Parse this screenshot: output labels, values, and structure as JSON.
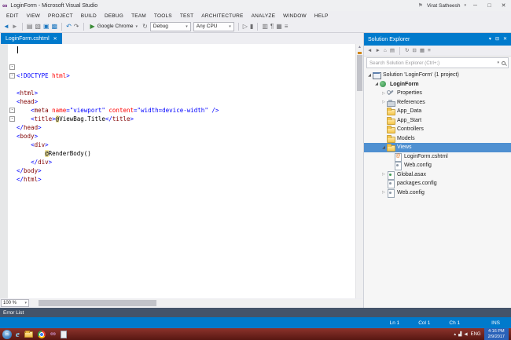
{
  "window": {
    "logo_glyph": "∞",
    "title": "LoginForm - Microsoft Visual Studio",
    "flag_glyph": "⚑",
    "user": "Virat Satheesh",
    "user_caret": "▾",
    "min": "─",
    "max": "□",
    "close": "✕"
  },
  "menubar": {
    "items": [
      "EDIT",
      "VIEW",
      "PROJECT",
      "BUILD",
      "DEBUG",
      "TEAM",
      "TOOLS",
      "TEST",
      "ARCHITECTURE",
      "ANALYZE",
      "WINDOW",
      "HELP"
    ]
  },
  "toolbar": {
    "icons_left": [
      {
        "name": "back-icon",
        "glyph": "◄",
        "color": "#1b76c0"
      },
      {
        "name": "forward-icon",
        "glyph": "►",
        "color": "#8a8a8e"
      },
      {
        "sep": true
      },
      {
        "name": "new-file-icon",
        "glyph": "▤"
      },
      {
        "name": "open-file-icon",
        "glyph": "▧"
      },
      {
        "name": "save-icon",
        "glyph": "▣",
        "color": "#1b76c0"
      },
      {
        "name": "save-all-icon",
        "glyph": "▩",
        "color": "#1b76c0"
      },
      {
        "sep": true
      },
      {
        "name": "undo-icon",
        "glyph": "↶",
        "color": "#1b76c0"
      },
      {
        "name": "redo-icon",
        "glyph": "↷"
      },
      {
        "sep": true
      }
    ],
    "run": {
      "play_glyph": "▶",
      "label": "Google Chrome",
      "caret": "▾"
    },
    "refresh_glyph": "↻",
    "dropdowns": [
      {
        "value": "Debug",
        "caret": "▾"
      },
      {
        "value": "Any CPU",
        "caret": "▾"
      }
    ],
    "icons_right": [
      {
        "sep": true
      },
      {
        "name": "start-without-debugging-icon",
        "glyph": "▷"
      },
      {
        "name": "break-all-icon",
        "glyph": "▮"
      },
      {
        "sep": true
      },
      {
        "name": "find-in-files-icon",
        "glyph": "▥"
      },
      {
        "name": "comment-icon",
        "glyph": "¶"
      },
      {
        "name": "bookmark-icon",
        "glyph": "▦"
      },
      {
        "name": "navigate-icon",
        "glyph": "≡"
      }
    ]
  },
  "editor": {
    "tab": {
      "label": "LoginForm.cshtml",
      "close": "✕"
    },
    "zoom": {
      "value": "100 %",
      "caret": "▾"
    },
    "code": [
      {
        "n": 1,
        "fold": false,
        "segs": [
          [
            "d",
            "<!DOCTYPE "
          ],
          [
            "a",
            "html"
          ],
          [
            "d",
            ">"
          ]
        ]
      },
      {
        "n": 2,
        "fold": false,
        "segs": []
      },
      {
        "n": 3,
        "fold": true,
        "segs": [
          [
            "d",
            "<"
          ],
          [
            "t",
            "html"
          ],
          [
            "d",
            ">"
          ]
        ]
      },
      {
        "n": 4,
        "fold": true,
        "segs": [
          [
            "d",
            "<"
          ],
          [
            "t",
            "head"
          ],
          [
            "d",
            ">"
          ]
        ]
      },
      {
        "n": 5,
        "fold": false,
        "segs": [
          [
            "p",
            "    "
          ],
          [
            "d",
            "<"
          ],
          [
            "t",
            "meta"
          ],
          [
            "p",
            " "
          ],
          [
            "a",
            "name"
          ],
          [
            "d",
            "=\""
          ],
          [
            "v",
            "viewport"
          ],
          [
            "d",
            "\""
          ],
          [
            "p",
            " "
          ],
          [
            "a",
            "content"
          ],
          [
            "d",
            "=\""
          ],
          [
            "v",
            "width=device-width"
          ],
          [
            "d",
            "\""
          ],
          [
            "p",
            " "
          ],
          [
            "d",
            "/>"
          ]
        ]
      },
      {
        "n": 6,
        "fold": false,
        "segs": [
          [
            "p",
            "    "
          ],
          [
            "d",
            "<"
          ],
          [
            "t",
            "title"
          ],
          [
            "d",
            ">"
          ],
          [
            "r",
            "@"
          ],
          [
            "p",
            "ViewBag.Title"
          ],
          [
            "d",
            "</"
          ],
          [
            "t",
            "title"
          ],
          [
            "d",
            ">"
          ]
        ]
      },
      {
        "n": 7,
        "fold": false,
        "segs": [
          [
            "d",
            "</"
          ],
          [
            "t",
            "head"
          ],
          [
            "d",
            ">"
          ]
        ]
      },
      {
        "n": 8,
        "fold": true,
        "segs": [
          [
            "d",
            "<"
          ],
          [
            "t",
            "body"
          ],
          [
            "d",
            ">"
          ]
        ]
      },
      {
        "n": 9,
        "fold": true,
        "segs": [
          [
            "p",
            "    "
          ],
          [
            "d",
            "<"
          ],
          [
            "t",
            "div"
          ],
          [
            "d",
            ">"
          ]
        ]
      },
      {
        "n": 10,
        "fold": false,
        "segs": [
          [
            "p",
            "        "
          ],
          [
            "r",
            "@"
          ],
          [
            "p",
            "RenderBody()"
          ]
        ]
      },
      {
        "n": 11,
        "fold": false,
        "segs": [
          [
            "p",
            "    "
          ],
          [
            "d",
            "</"
          ],
          [
            "t",
            "div"
          ],
          [
            "d",
            ">"
          ]
        ]
      },
      {
        "n": 12,
        "fold": false,
        "segs": [
          [
            "d",
            "</"
          ],
          [
            "t",
            "body"
          ],
          [
            "d",
            ">"
          ]
        ]
      },
      {
        "n": 13,
        "fold": false,
        "segs": [
          [
            "d",
            "</"
          ],
          [
            "t",
            "html"
          ],
          [
            "d",
            ">"
          ]
        ]
      }
    ]
  },
  "solution_explorer": {
    "title": "Solution Explorer",
    "header_icons": [
      {
        "name": "window-position-icon",
        "glyph": "▾"
      },
      {
        "name": "auto-hide-pin-icon",
        "glyph": "⊟"
      },
      {
        "name": "close-icon",
        "glyph": "✕"
      }
    ],
    "toolbar_icons": [
      {
        "name": "back-icon",
        "glyph": "◄"
      },
      {
        "name": "forward-icon",
        "glyph": "►"
      },
      {
        "name": "home-icon",
        "glyph": "⌂"
      },
      {
        "name": "switch-views-icon",
        "glyph": "▤"
      },
      {
        "sep": true
      },
      {
        "name": "sync-with-active-document-icon",
        "glyph": "↻"
      },
      {
        "name": "collapse-all-icon",
        "glyph": "⊟"
      },
      {
        "name": "show-all-files-icon",
        "glyph": "▦"
      },
      {
        "name": "properties-icon",
        "glyph": "≡"
      }
    ],
    "search": {
      "placeholder": "Search Solution Explorer (Ctrl+;)",
      "caret": "▾"
    },
    "tree": [
      {
        "depth": 0,
        "arrow": "expanded",
        "icon": "solution",
        "label": "Solution 'LoginForm' (1 project)"
      },
      {
        "depth": 1,
        "arrow": "expanded",
        "icon": "project",
        "label": "LoginForm",
        "bold": true
      },
      {
        "depth": 2,
        "arrow": "collapsed",
        "icon": "properties",
        "label": "Properties"
      },
      {
        "depth": 2,
        "arrow": "collapsed",
        "icon": "references",
        "label": "References"
      },
      {
        "depth": 2,
        "arrow": "none",
        "icon": "folder",
        "label": "App_Data"
      },
      {
        "depth": 2,
        "arrow": "none",
        "icon": "folder",
        "label": "App_Start"
      },
      {
        "depth": 2,
        "arrow": "none",
        "icon": "folder",
        "label": "Controllers"
      },
      {
        "depth": 2,
        "arrow": "none",
        "icon": "folder",
        "label": "Models"
      },
      {
        "depth": 2,
        "arrow": "expanded",
        "icon": "folder",
        "label": "Views",
        "selected": true
      },
      {
        "depth": 3,
        "arrow": "none",
        "icon": "cshtml",
        "label": "LoginForm.cshtml"
      },
      {
        "depth": 3,
        "arrow": "none",
        "icon": "config",
        "label": "Web.config"
      },
      {
        "depth": 2,
        "arrow": "collapsed",
        "icon": "asax",
        "label": "Global.asax"
      },
      {
        "depth": 2,
        "arrow": "none",
        "icon": "config",
        "label": "packages.config"
      },
      {
        "depth": 2,
        "arrow": "collapsed",
        "icon": "config",
        "label": "Web.config"
      }
    ]
  },
  "error_list": {
    "title": "Error List"
  },
  "status_bar": {
    "items": [
      "Ln 1",
      "Col 1",
      "Ch 1",
      "INS"
    ]
  },
  "taskbar": {
    "start_glyph": "⊞",
    "icons": [
      {
        "name": "internet-explorer-icon",
        "style": "ie",
        "glyph": "e"
      },
      {
        "name": "file-explorer-icon",
        "style": "folder"
      },
      {
        "name": "chrome-icon",
        "style": "chrome"
      },
      {
        "name": "visual-studio-icon",
        "style": "vs",
        "glyph": "∞"
      },
      {
        "name": "notepad-icon",
        "style": "doc"
      }
    ],
    "tray": {
      "icons": [
        {
          "name": "show-hidden-icons-icon",
          "glyph": "▴"
        },
        {
          "name": "network-icon",
          "glyph": "▟"
        },
        {
          "name": "volume-icon",
          "glyph": "◀"
        }
      ],
      "lang": "ENG",
      "time": "4:16 PM",
      "date": "2/9/2017"
    }
  }
}
